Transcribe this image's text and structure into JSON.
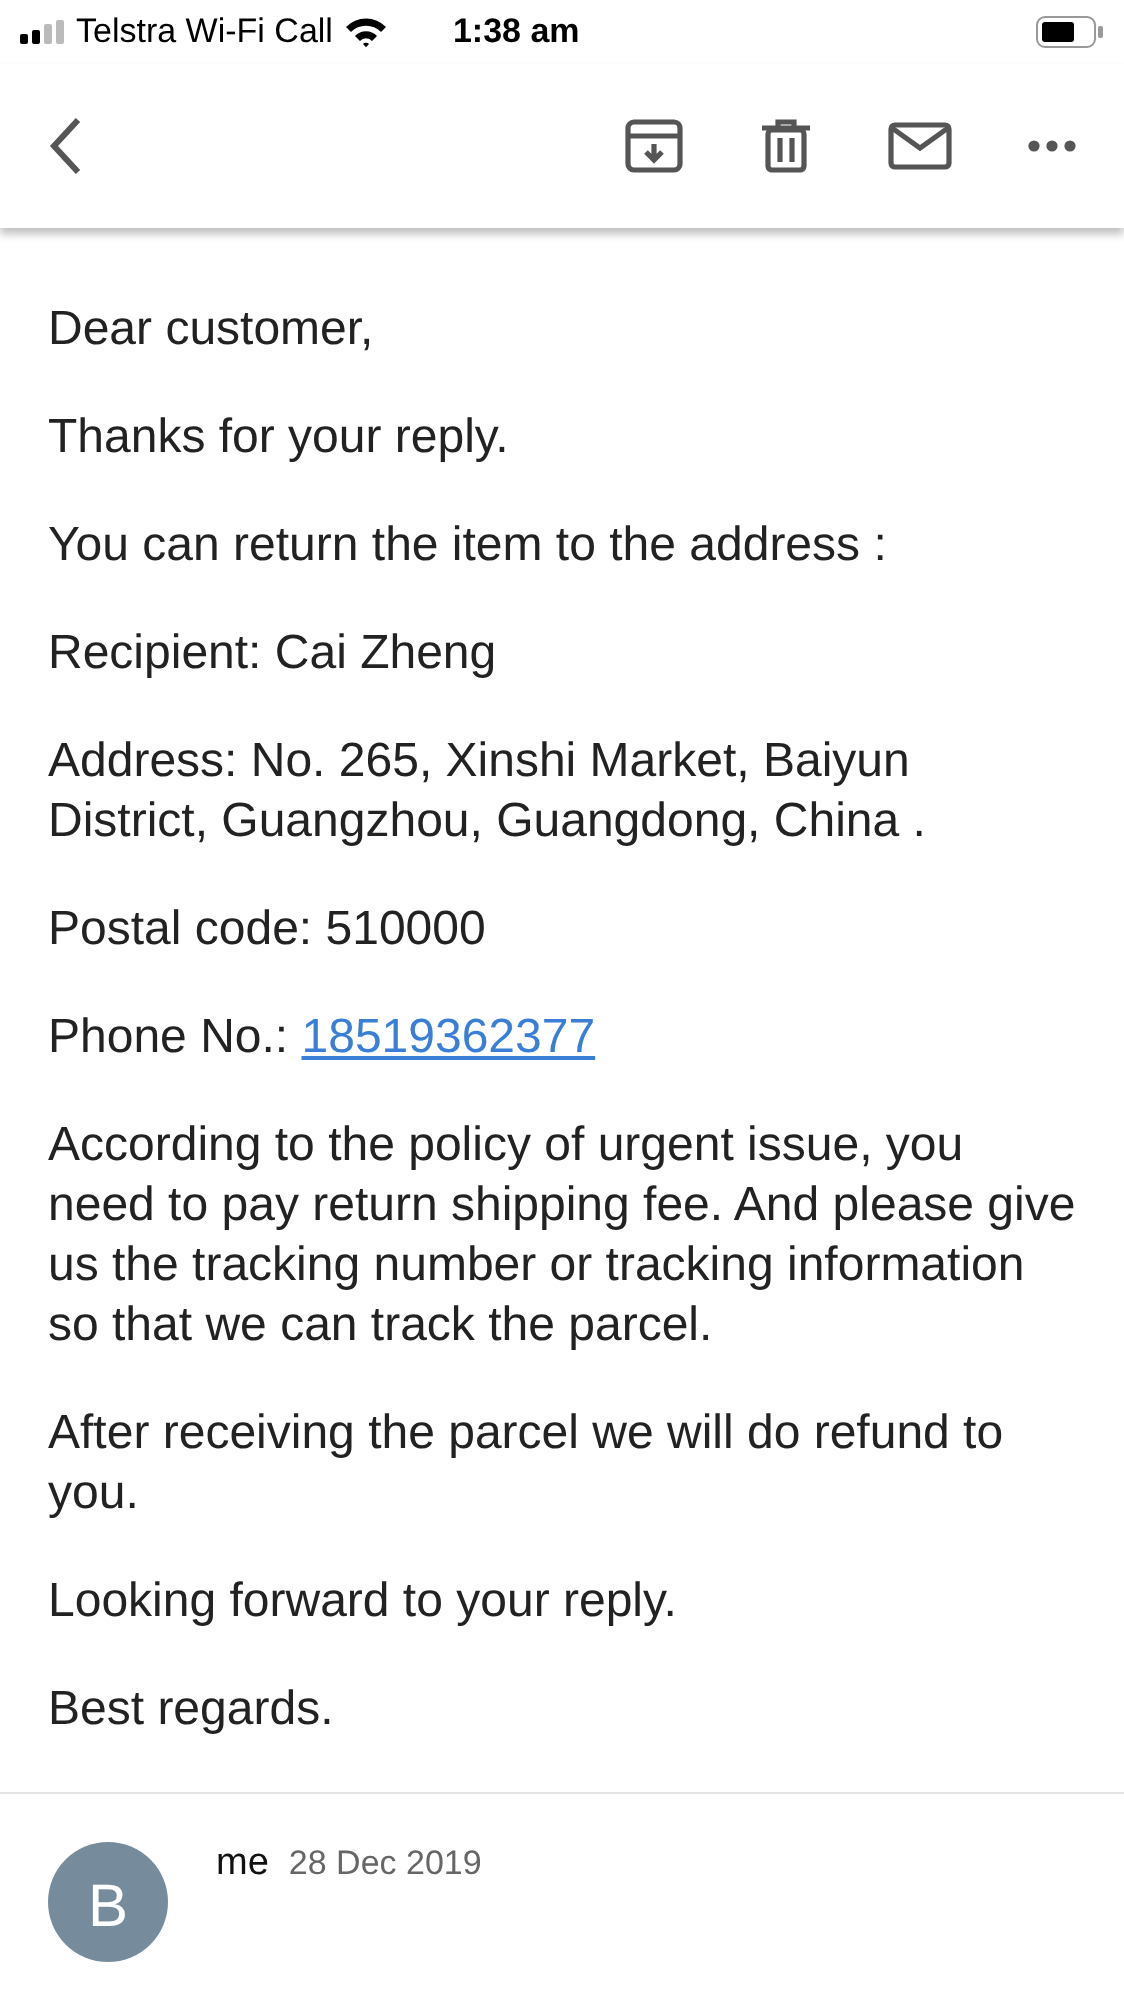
{
  "status_bar": {
    "carrier": "Telstra Wi-Fi Call",
    "time": "1:38 am"
  },
  "body": [
    {
      "kind": "text",
      "text": "Dear customer,"
    },
    {
      "kind": "text",
      "text": "Thanks for your reply."
    },
    {
      "kind": "text",
      "text": "You can return the item to the address :"
    },
    {
      "kind": "text",
      "text": "Recipient: Cai Zheng"
    },
    {
      "kind": "text",
      "text": "Address: No. 265, Xinshi Market, Baiyun District, Guangzhou, Guangdong, China ."
    },
    {
      "kind": "text",
      "text": "Postal code: 510000"
    },
    {
      "kind": "link",
      "text": "Phone No.:",
      "link": "18519362377"
    },
    {
      "kind": "text",
      "text": "According to the policy of urgent issue, you need to pay return shipping fee. And please give us the tracking number or tracking information so that we can track the parcel."
    },
    {
      "kind": "text",
      "text": "After receiving the parcel we will do refund to you."
    },
    {
      "kind": "text",
      "text": "Looking forward to your reply."
    },
    {
      "kind": "text",
      "text": "Best regards."
    }
  ],
  "next_message": {
    "avatar": "B",
    "sender": "me",
    "date": "28 Dec 2019"
  }
}
